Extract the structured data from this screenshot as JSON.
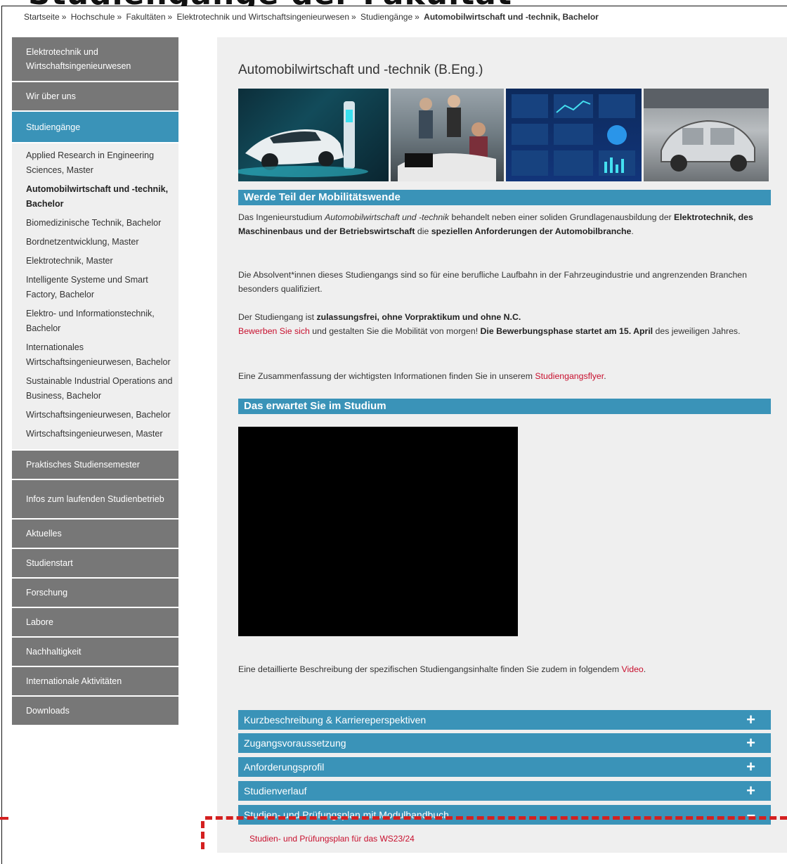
{
  "top_title_partial": "Studiengänge der Fakultät",
  "breadcrumb": {
    "items": [
      "Startseite",
      "Hochschule",
      "Fakultäten",
      "Elektrotechnik und Wirtschaftsingenieurwesen",
      "Studiengänge"
    ],
    "separator": "»",
    "current": "Automobilwirtschaft und -technik, Bachelor"
  },
  "sidebar": {
    "top": [
      "Elektrotechnik und Wirtschaftsingenieurwesen",
      "Wir über uns"
    ],
    "active": "Studiengänge",
    "sub": [
      "Applied Research in Engineering Sciences, Master",
      "Automobilwirtschaft und -technik, Bachelor",
      "Biomedizinische Technik, Bachelor",
      "Bordnetzentwicklung, Master",
      "Elektrotechnik, Master",
      "Intelligente Systeme und Smart Factory, Bachelor",
      "Elektro- und Informationstechnik, Bachelor",
      "Internationales Wirtschaftsingenieurwesen, Bachelor",
      "Sustainable Industrial Operations and Business, Bachelor",
      "Wirtschaftsingenieurwesen, Bachelor",
      "Wirtschaftsingenieurwesen, Master"
    ],
    "bottom": [
      "Praktisches Studiensemester",
      "Infos zum laufenden Studienbetrieb",
      "Aktuelles",
      "Studienstart",
      "Forschung",
      "Labore",
      "Nachhaltigkeit",
      "Internationale Aktivitäten",
      "Downloads"
    ]
  },
  "main": {
    "title": "Automobilwirtschaft und -technik (B.Eng.)",
    "section1": "Werde Teil der Mobilitätswende",
    "p1": {
      "a": "Das Ingenieurstudium ",
      "italic": "Automobilwirtschaft und -technik",
      "b": " behandelt neben einer soliden Grundlagenausbildung der ",
      "bold1": "Elektrotechnik, des Maschinenbaus und der Betriebswirtschaft",
      "c": " die ",
      "bold2": "speziellen Anforderungen der Automobilbranche",
      "d": "."
    },
    "p2": "Die Absolvent*innen dieses Studiengangs sind so für eine berufliche Laufbahn in der Fahrzeugindustrie und angrenzenden Branchen besonders qualifiziert.",
    "p3": {
      "a": "Der Studiengang ist ",
      "bold": "zulassungsfrei, ohne Vorpraktikum und ohne N.C.",
      "link": "Bewerben Sie sich",
      "b": " und gestalten Sie die Mobilität von morgen! ",
      "bold2": "Die Bewerbungsphase startet am 15. April",
      "c": " des jeweiligen Jahres."
    },
    "p4": {
      "a": "Eine Zusammenfassung der wichtigsten Informationen finden Sie in unserem ",
      "link": "Studiengangsflyer",
      "b": "."
    },
    "section2": "Das erwartet Sie im Studium",
    "p5": {
      "a": "Eine detaillierte Beschreibung der spezifischen Studiengangsinhalte finden Sie zudem in folgendem ",
      "link": "Video",
      "b": "."
    },
    "accordion": [
      {
        "label": "Kurzbeschreibung & Karriereperspektiven",
        "icon": "+"
      },
      {
        "label": "Zugangsvoraussetzung",
        "icon": "+"
      },
      {
        "label": "Anforderungsprofil",
        "icon": "+"
      },
      {
        "label": "Studienverlauf",
        "icon": "+"
      },
      {
        "label": "Studien- und Prüfungsplan mit Modulhandbuch",
        "icon": "–"
      }
    ],
    "download_link": "Studien- und Prüfungsplan für das WS23/24"
  },
  "colors": {
    "accent": "#3a93b8",
    "sidebar_dark": "#777777",
    "link": "#c8102e",
    "highlight": "#d42020"
  }
}
